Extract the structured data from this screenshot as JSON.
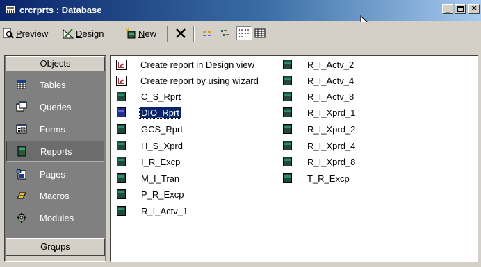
{
  "window": {
    "title": "crcrprts : Database",
    "controls": [
      "minimize",
      "maximize",
      "close"
    ]
  },
  "toolbar": {
    "preview_label": "Preview",
    "preview_key": "P",
    "preview_rest": "review",
    "design_label": "Design",
    "design_key": "D",
    "design_rest": "esign",
    "new_label": "New",
    "new_key": "N",
    "new_rest": "ew",
    "view_modes": [
      "large-icons",
      "small-icons",
      "list",
      "details"
    ],
    "active_view": "list"
  },
  "sidebar": {
    "objects_header": "Objects",
    "groups_header": "Groups",
    "items": [
      {
        "label": "Tables",
        "icon": "table-icon",
        "active": false
      },
      {
        "label": "Queries",
        "icon": "query-icon",
        "active": false
      },
      {
        "label": "Forms",
        "icon": "form-icon",
        "active": false
      },
      {
        "label": "Reports",
        "icon": "report-icon",
        "active": true
      },
      {
        "label": "Pages",
        "icon": "page-icon",
        "active": false
      },
      {
        "label": "Macros",
        "icon": "macro-icon",
        "active": false
      },
      {
        "label": "Modules",
        "icon": "module-icon",
        "active": false
      }
    ]
  },
  "list": {
    "col1": [
      {
        "label": "Create report in Design view",
        "kind": "shortcut"
      },
      {
        "label": "Create report by using wizard",
        "kind": "shortcut"
      },
      {
        "label": "C_S_Rprt",
        "kind": "report"
      },
      {
        "label": "DIO_Rprt",
        "kind": "report",
        "selected": true
      },
      {
        "label": "GCS_Rprt",
        "kind": "report"
      },
      {
        "label": "H_S_Xprd",
        "kind": "report"
      },
      {
        "label": "I_R_Excp",
        "kind": "report"
      },
      {
        "label": "M_I_Tran",
        "kind": "report"
      },
      {
        "label": "P_R_Excp",
        "kind": "report"
      },
      {
        "label": "R_I_Actv_1",
        "kind": "report"
      }
    ],
    "col2": [
      {
        "label": "R_I_Actv_2",
        "kind": "report"
      },
      {
        "label": "R_I_Actv_4",
        "kind": "report"
      },
      {
        "label": "R_I_Actv_8",
        "kind": "report"
      },
      {
        "label": "R_I_Xprd_1",
        "kind": "report"
      },
      {
        "label": "R_I_Xprd_2",
        "kind": "report"
      },
      {
        "label": "R_I_Xprd_4",
        "kind": "report"
      },
      {
        "label": "R_I_Xprd_8",
        "kind": "report"
      },
      {
        "label": "T_R_Excp",
        "kind": "report"
      }
    ]
  },
  "colors": {
    "title_start": "#0a246a",
    "title_end": "#a6caf0",
    "face": "#d4d0c8",
    "sidebar_bg": "#808080",
    "selection": "#0a246a"
  }
}
